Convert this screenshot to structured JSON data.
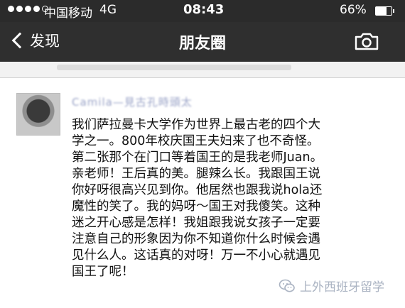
{
  "status_bar": {
    "carrier": "中国移动",
    "network": "4G",
    "time": "08:43",
    "battery_percent": "66%",
    "battery_level": 0.66
  },
  "nav": {
    "back_label": "发现",
    "title": "朋友圈"
  },
  "post": {
    "author": "Camila—見古孔時頭太",
    "text": "我们萨拉曼卡大学作为世界上最古老的四个大\n学之一。800年校庆国王夫妇来了也不奇怪。\n第二张那个在门口等着国王的是我老师Juan。\n亲老师！王后真的美。腿辣么长。我跟国王说\n你好呀很高兴见到你。他居然也跟我说hola还\n魔性的笑了。我的妈呀～国王对我傻笑。这种\n迷之开心感是怎样！我姐跟我说女孩子一定要\n注意自己的形象因为你不知道你什么时候会遇\n见什么人。这话真的对呀！万一不小心就遇见\n国王了呢！"
  },
  "watermark": {
    "text": "上外西班牙留学"
  },
  "colors": {
    "nav_bg": "#2f2f2f",
    "status_bg": "#2b2b2b",
    "watermark": "#aab3c2"
  }
}
